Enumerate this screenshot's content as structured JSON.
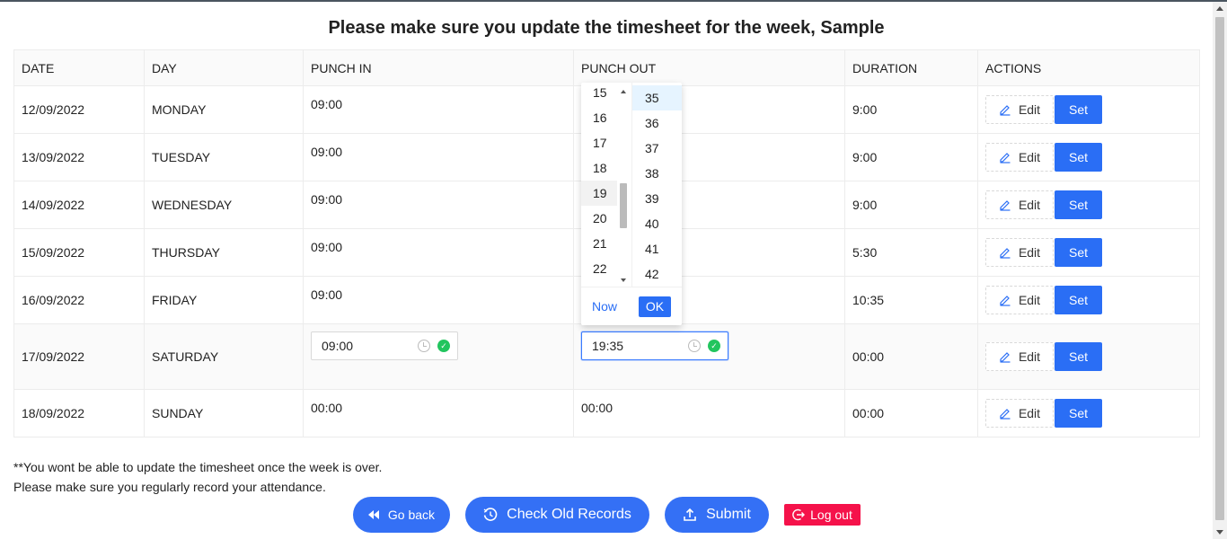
{
  "title": "Please make sure you update the timesheet for the week, Sample",
  "table": {
    "headers": [
      "DATE",
      "DAY",
      "PUNCH IN",
      "PUNCH OUT",
      "DURATION",
      "ACTIONS"
    ],
    "rows": [
      {
        "date": "12/09/2022",
        "day": "MONDAY",
        "punch_in": "09:00",
        "punch_out": "",
        "duration": "9:00"
      },
      {
        "date": "13/09/2022",
        "day": "TUESDAY",
        "punch_in": "09:00",
        "punch_out": "",
        "duration": "9:00"
      },
      {
        "date": "14/09/2022",
        "day": "WEDNESDAY",
        "punch_in": "09:00",
        "punch_out": "",
        "duration": "9:00"
      },
      {
        "date": "15/09/2022",
        "day": "THURSDAY",
        "punch_in": "09:00",
        "punch_out": "",
        "duration": "5:30"
      },
      {
        "date": "16/09/2022",
        "day": "FRIDAY",
        "punch_in": "09:00",
        "punch_out": "",
        "duration": "10:35"
      },
      {
        "date": "17/09/2022",
        "day": "SATURDAY",
        "punch_in": "09:00",
        "punch_out": "19:35",
        "duration": "00:00",
        "editing": true
      },
      {
        "date": "18/09/2022",
        "day": "SUNDAY",
        "punch_in": "00:00",
        "punch_out": "00:00",
        "duration": "00:00"
      }
    ],
    "edit_label": "Edit",
    "set_label": "Set"
  },
  "time_picker": {
    "hours": [
      "15",
      "16",
      "17",
      "18",
      "19",
      "20",
      "21",
      "22"
    ],
    "minutes": [
      "35",
      "36",
      "37",
      "38",
      "39",
      "40",
      "41",
      "42"
    ],
    "selected_hour": "19",
    "selected_minute": "35",
    "now_label": "Now",
    "ok_label": "OK"
  },
  "notes": {
    "line1": "**You wont be able to update the timesheet once the week is over.",
    "line2": "Please make sure you regularly record your attendance."
  },
  "buttons": {
    "go_back": "Go back",
    "check_old_records": "Check Old Records",
    "submit": "Submit",
    "log_out": "Log out"
  },
  "colors": {
    "primary": "#2a6ef5",
    "logout": "#f5124a",
    "check": "#22c55e"
  }
}
